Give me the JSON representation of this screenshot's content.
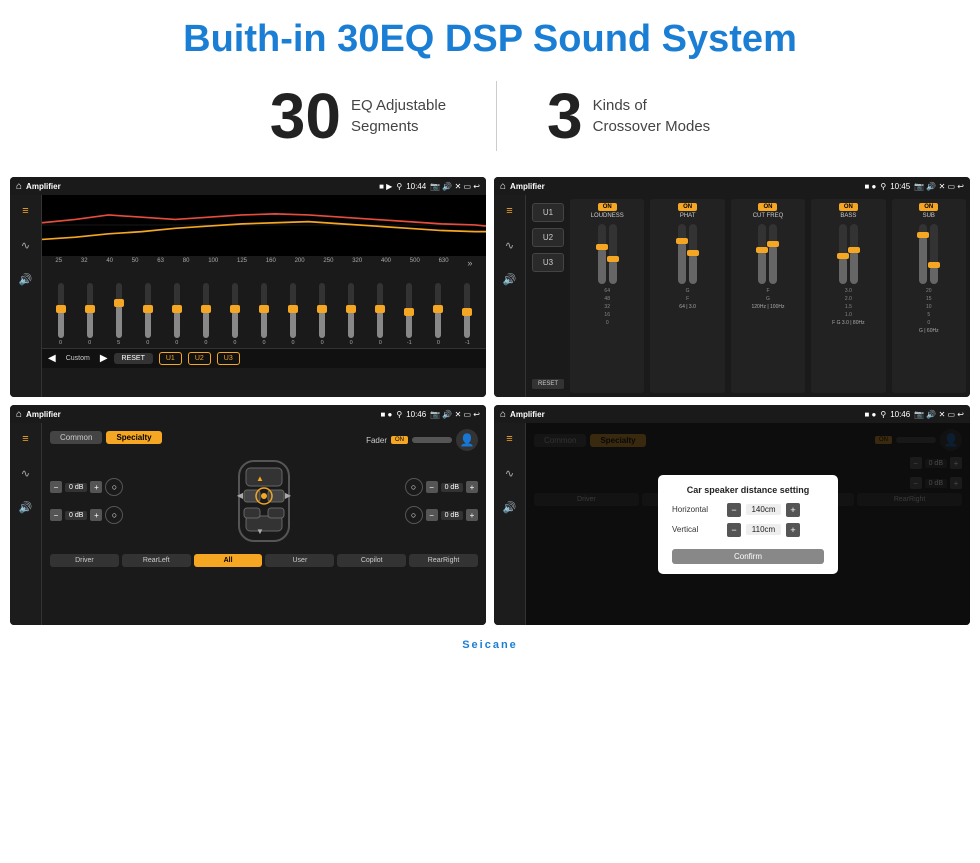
{
  "page": {
    "title": "Buith-in 30EQ DSP Sound System",
    "stat1_number": "30",
    "stat1_desc_line1": "EQ Adjustable",
    "stat1_desc_line2": "Segments",
    "stat2_number": "3",
    "stat2_desc_line1": "Kinds of",
    "stat2_desc_line2": "Crossover Modes"
  },
  "screen1": {
    "status_bar": {
      "title": "Amplifier",
      "time": "10:44"
    },
    "eq_labels": [
      "25",
      "32",
      "40",
      "50",
      "63",
      "80",
      "100",
      "125",
      "160",
      "200",
      "250",
      "320",
      "400",
      "500",
      "630"
    ],
    "bottom_buttons": {
      "prev": "◀",
      "label": "Custom",
      "next": "▶",
      "reset": "RESET",
      "u1": "U1",
      "u2": "U2",
      "u3": "U3"
    }
  },
  "screen2": {
    "status_bar": {
      "title": "Amplifier",
      "time": "10:45"
    },
    "u_buttons": [
      "U1",
      "U2",
      "U3"
    ],
    "columns": [
      {
        "toggle": "ON",
        "title": "LOUDNESS"
      },
      {
        "toggle": "ON",
        "title": "PHAT"
      },
      {
        "toggle": "ON",
        "title": "CUT FREQ"
      },
      {
        "toggle": "ON",
        "title": "BASS"
      },
      {
        "toggle": "ON",
        "title": "SUB"
      }
    ],
    "reset_label": "RESET"
  },
  "screen3": {
    "status_bar": {
      "title": "Amplifier",
      "time": "10:46"
    },
    "tabs": [
      "Common",
      "Specialty"
    ],
    "fader_label": "Fader",
    "fader_toggle": "ON",
    "channels": {
      "left_top": "0 dB",
      "left_bottom": "0 dB",
      "right_top": "0 dB",
      "right_bottom": "0 dB"
    },
    "bottom_buttons": [
      "Driver",
      "RearLeft",
      "All",
      "User",
      "Copilot",
      "RearRight"
    ]
  },
  "screen4": {
    "status_bar": {
      "title": "Amplifier",
      "time": "10:46"
    },
    "tabs": [
      "Common",
      "Specialty"
    ],
    "modal": {
      "title": "Car speaker distance setting",
      "horizontal_label": "Horizontal",
      "horizontal_value": "140cm",
      "vertical_label": "Vertical",
      "vertical_value": "110cm",
      "confirm_label": "Confirm"
    },
    "channels": {
      "right_top": "0 dB",
      "right_bottom": "0 dB"
    },
    "bottom_buttons": [
      "Driver",
      "RearLeft...",
      "Copilot",
      "RearRight"
    ]
  },
  "watermark": "Seicane"
}
